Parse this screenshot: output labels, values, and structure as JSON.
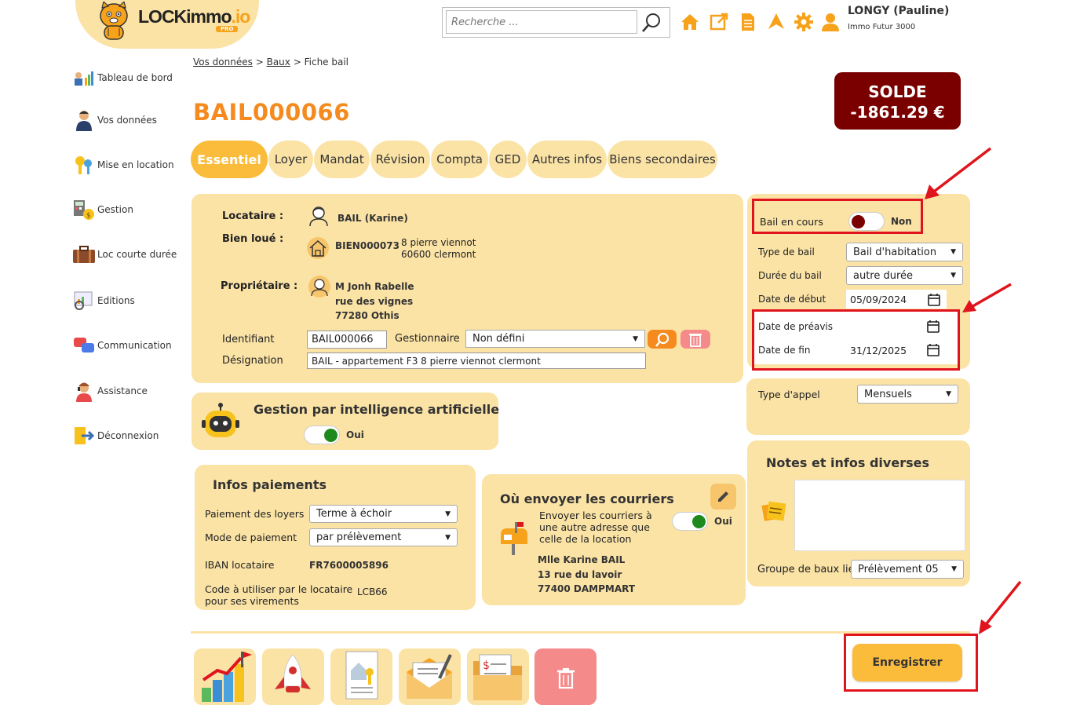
{
  "header": {
    "logo_main": "LOCKimmo",
    "logo_ext": ".io",
    "logo_badge": "PRO",
    "search_placeholder": "Recherche ...",
    "user_name": "LONGY (Pauline)",
    "user_company": "Immo Futur 3000",
    "icons": [
      "home-icon",
      "external-link-icon",
      "document-icon",
      "navigation-icon",
      "gear-icon",
      "user-icon"
    ]
  },
  "sidebar": {
    "items": [
      {
        "label": "Tableau de bord",
        "icon": "dashboard-icon"
      },
      {
        "label": "Vos données",
        "icon": "person-icon"
      },
      {
        "label": "Mise en location",
        "icon": "keys-icon"
      },
      {
        "label": "Gestion",
        "icon": "calculator-icon"
      },
      {
        "label": "Loc courte durée",
        "icon": "suitcase-icon"
      },
      {
        "label": "Editions",
        "icon": "report-icon"
      },
      {
        "label": "Communication",
        "icon": "chat-icon"
      },
      {
        "label": "Assistance",
        "icon": "support-icon"
      },
      {
        "label": "Déconnexion",
        "icon": "logout-icon"
      }
    ]
  },
  "breadcrumb": {
    "item1": "Vos données",
    "sep": ">",
    "item2": "Baux",
    "current": "Fiche bail"
  },
  "page_title": "BAIL000066",
  "solde": {
    "label": "SOLDE",
    "value": "-1861.29 €"
  },
  "tabs": [
    "Essentiel",
    "Loyer",
    "Mandat",
    "Révision",
    "Compta",
    "GED",
    "Autres infos",
    "Biens secondaires"
  ],
  "main": {
    "locataire_label": "Locataire :",
    "locataire_value": "BAIL (Karine)",
    "bien_label": "Bien loué :",
    "bien_code": "BIEN000073",
    "bien_addr1": "8 pierre viennot",
    "bien_addr2": "60600 clermont",
    "proprio_label": "Propriétaire :",
    "proprio_name": "M Jonh Rabelle",
    "proprio_addr1": "rue des vignes",
    "proprio_addr2": "77280 Othis",
    "identifiant_label": "Identifiant",
    "identifiant_value": "BAIL000066",
    "gestionnaire_label": "Gestionnaire",
    "gestionnaire_value": "Non défini",
    "designation_label": "Désignation",
    "designation_value": "BAIL - appartement F3 8 pierre viennot clermont"
  },
  "ai": {
    "title": "Gestion par intelligence artificielle",
    "toggle_label": "Oui"
  },
  "payments": {
    "title": "Infos paiements",
    "loyers_label": "Paiement des loyers",
    "loyers_value": "Terme à échoir",
    "mode_label": "Mode de paiement",
    "mode_value": "par prélèvement",
    "iban_label": "IBAN locataire",
    "iban_value": "FR7600005896",
    "code_label1": "Code à utiliser par le locataire",
    "code_label2": "pour ses virements",
    "code_value": "LCB66"
  },
  "mail": {
    "title": "Où envoyer les courriers",
    "desc1": "Envoyer les courriers à",
    "desc2": "une autre adresse que",
    "desc3": "celle de la location",
    "toggle_label": "Oui",
    "name": "Mlle Karine BAIL",
    "addr1": "13 rue du lavoir",
    "addr2": "77400 DAMPMART"
  },
  "right": {
    "bail_en_cours_label": "Bail en cours",
    "bail_en_cours_value": "Non",
    "type_label": "Type de bail",
    "type_value": "Bail d'habitation",
    "duree_label": "Durée du bail",
    "duree_value": "autre durée",
    "debut_label": "Date de début",
    "debut_value": "05/09/2024",
    "preavis_label": "Date de préavis",
    "preavis_value": "",
    "fin_label": "Date de fin",
    "fin_value": "31/12/2025",
    "appel_label": "Type d'appel",
    "appel_value": "Mensuels",
    "notes_title": "Notes et infos diverses",
    "notes_value": "",
    "groupe_label": "Groupe de baux lié",
    "groupe_value": "Prélèvement 05"
  },
  "actions": {
    "save_label": "Enregistrer"
  },
  "colors": {
    "accent": "#f58a1f",
    "panel": "#fbe3a6",
    "tab_active": "#fbbc3b",
    "solde_bg": "#7a0000",
    "annotation": "#e0141c"
  }
}
